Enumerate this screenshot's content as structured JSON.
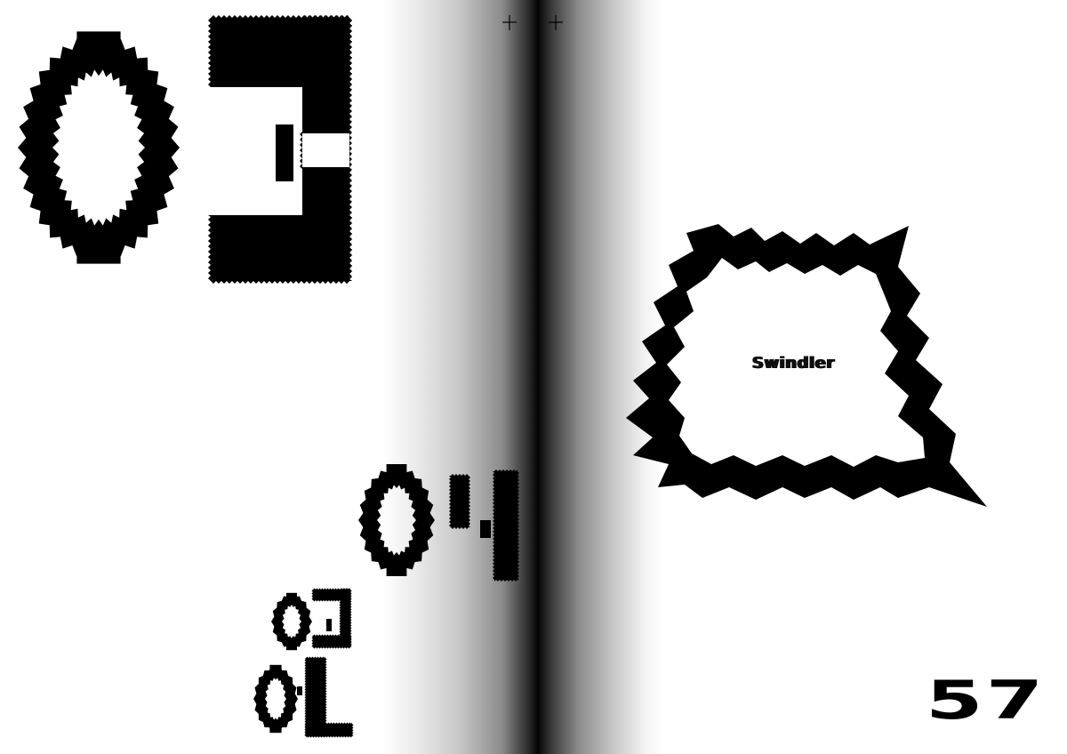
{
  "spread": {
    "glyphs": {
      "large_top": "03",
      "medium": "04",
      "small_top": "02",
      "small_bottom": "01"
    },
    "speech_bubble": {
      "text": "Swindler"
    },
    "page_number": "57"
  },
  "colors": {
    "ink": "#000000",
    "paper": "#ffffff",
    "gutter_shadow": "#050505"
  },
  "icons": [
    "crop-mark-icon",
    "speech-bubble-shape"
  ]
}
